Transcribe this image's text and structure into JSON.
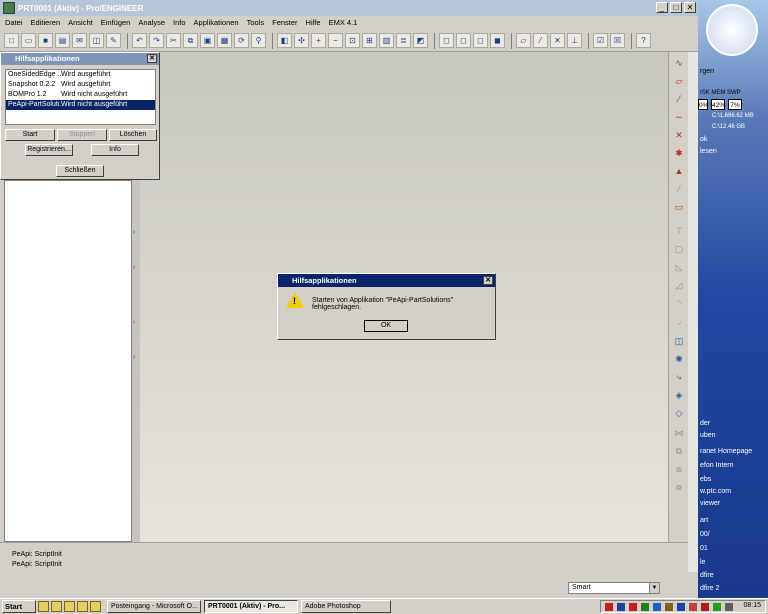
{
  "window": {
    "title": "PRT0001 (Aktiv) - Pro/ENGINEER",
    "btn_min": "_",
    "btn_max": "□",
    "btn_close": "✕"
  },
  "menu": [
    "Datei",
    "Editieren",
    "Ansicht",
    "Einfügen",
    "Analyse",
    "Info",
    "Applikationen",
    "Tools",
    "Fenster",
    "Hilfe",
    "EMX 4.1"
  ],
  "hilfs": {
    "title": "Hilfsapplikationen",
    "close": "✕",
    "rows": [
      {
        "name": "OneSidedEdge ...",
        "status": "Wird ausgeführt"
      },
      {
        "name": "Snapshot 0.2.2",
        "status": "Wird ausgeführt"
      },
      {
        "name": "BOMPro 1.2",
        "status": "Wird nicht ausgeführt"
      },
      {
        "name": "PeApi-PartSoluti...",
        "status": "Wird nicht ausgeführt"
      }
    ],
    "btn_start": "Start",
    "btn_stoppen": "Stoppen",
    "btn_loeschen": "Löschen",
    "btn_registrieren": "Registrieren...",
    "btn_info": "Info",
    "btn_schliessen": "Schließen"
  },
  "errdlg": {
    "title": "Hilfsapplikationen",
    "close": "✕",
    "icon_mark": "!",
    "message": "Starten von Applikation \"PeApi-PartSolutions\" fehlgeschlagen.",
    "ok": "OK"
  },
  "messages": [
    "PeApi: ScriptInit",
    "PeApi: ScriptInit"
  ],
  "filter": {
    "value": "Smart",
    "dd": "▼"
  },
  "rightpanel": {
    "gen": "rgen",
    "meters_label": "ISK MEM SWP",
    "m1": "0%",
    "m2": "42%",
    "m3": "7%",
    "disk1": "C:\\1,696.62 MB",
    "disk2": "C:\\12.46 GB",
    "ok": "ok",
    "lesen": "lesen",
    "der": "der",
    "uben": "uben",
    "items": [
      "ranet Homepage",
      "efon Intern",
      "ebs",
      "w.ptc.com",
      "viewer",
      "art",
      "00/",
      "01",
      "le",
      "dfire",
      "dfire 2"
    ]
  },
  "taskbar": {
    "start": "Start",
    "tasks": [
      "Posteingang - Microsoft O...",
      "PRT0001 (Aktiv) - Pro...",
      "Adobe Photoshop"
    ],
    "time": "08:15"
  }
}
